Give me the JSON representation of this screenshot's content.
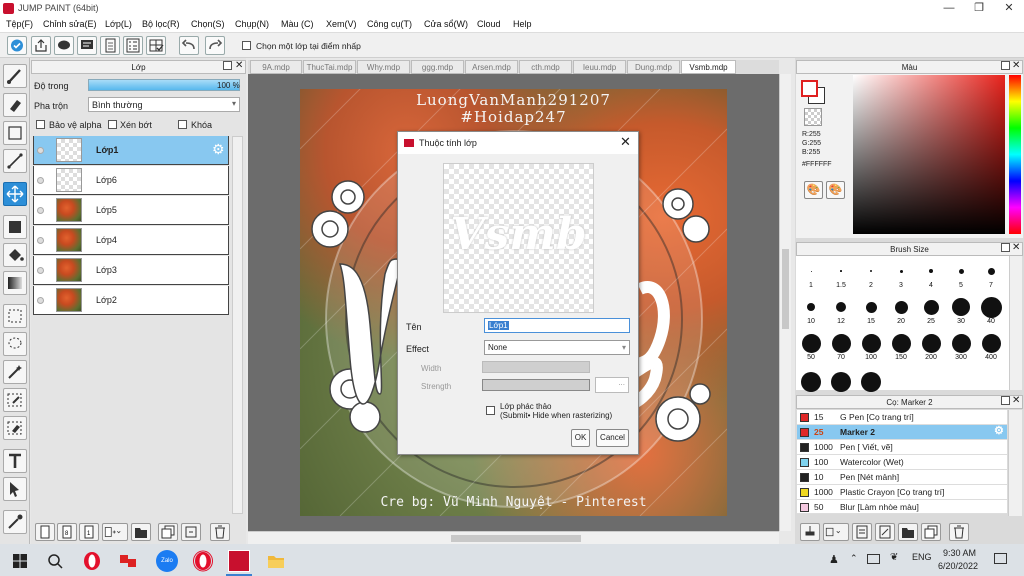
{
  "window": {
    "title": "JUMP PAINT (64bit)"
  },
  "menu": [
    "Tệp(F)",
    "Chỉnh sửa(E)",
    "Lớp(L)",
    "Bộ lọc(R)",
    "Chọn(S)",
    "Chụp(N)",
    "Màu (C)",
    "Xem(V)",
    "Công cụ(T)",
    "Cửa sổ(W)",
    "Cloud",
    "Help"
  ],
  "toolbar": {
    "reference_label": "Chọn một lớp tại điểm nhấp"
  },
  "layer_panel": {
    "title": "Lớp",
    "opacity_label": "Độ trong",
    "opacity_value": "100 %",
    "opacity_fraction": 1.0,
    "blend_label": "Pha trộn",
    "blend_value": "Bình thường",
    "protect_alpha": "Bảo vệ alpha",
    "clipping": "Xén bớt",
    "lock": "Khóa",
    "layers": [
      {
        "name": "Lớp1",
        "thumb": "transparent",
        "selected": true
      },
      {
        "name": "Lớp6",
        "thumb": "transparent",
        "selected": false
      },
      {
        "name": "Lớp5",
        "thumb": "photo",
        "selected": false
      },
      {
        "name": "Lớp4",
        "thumb": "photo",
        "selected": false
      },
      {
        "name": "Lớp3",
        "thumb": "photo",
        "selected": false
      },
      {
        "name": "Lớp2",
        "thumb": "photo",
        "selected": false
      }
    ]
  },
  "doc_tabs": [
    "9A.mdp",
    "ThucTai.mdp",
    "Why.mdp",
    "ggg.mdp",
    "Arsen.mdp",
    "cth.mdp",
    "Ieuu.mdp",
    "Dung.mdp",
    "Vsmb.mdp"
  ],
  "canvas": {
    "watermark_line1": "LuongVanManh291207",
    "watermark_line2": "#Hoidap247",
    "artwork_text": "Vsmb",
    "credit": "Cre bg: Vũ Minh Nguyệt - Pinterest"
  },
  "dialog": {
    "title": "Thuộc tính lớp",
    "name_label": "Tên",
    "name_value": "Lớp1",
    "effect_label": "Effect",
    "effect_value": "None",
    "width_label": "Width",
    "strength_label": "Strength",
    "strength_btn": "...",
    "draft_label": "Lớp phác thảo",
    "draft_note": "(Submit• Hide when rasterizing)",
    "ok": "OK",
    "cancel": "Cancel"
  },
  "color_panel": {
    "title": "Màu",
    "r": "R:255",
    "g": "G:255",
    "b": "B:255",
    "hex": "#FFFFFF",
    "primary_color": "#E02020",
    "secondary_color": "#FFFFFF"
  },
  "brush_panel": {
    "title": "Brush Size",
    "sizes": [
      "1",
      "1.5",
      "2",
      "3",
      "4",
      "5",
      "7",
      "10",
      "12",
      "15",
      "20",
      "25",
      "30",
      "40",
      "50",
      "70",
      "100",
      "150",
      "200",
      "300",
      "400"
    ]
  },
  "tool_panel": {
    "title": "Cọ: Marker 2",
    "tools": [
      {
        "size": "15",
        "name": "G Pen [Cọ trang trí]",
        "color": "#E02828",
        "selected": false
      },
      {
        "size": "25",
        "name": "Marker 2",
        "color": "#E02828",
        "selected": true
      },
      {
        "size": "1000",
        "name": "Pen [ Viết, vẽ]",
        "color": "#222222",
        "selected": false
      },
      {
        "size": "100",
        "name": "Watercolor (Wet)",
        "color": "#7FD4F0",
        "selected": false
      },
      {
        "size": "10",
        "name": "Pen [Nét mảnh]",
        "color": "#222222",
        "selected": false
      },
      {
        "size": "1000",
        "name": "Plastic Crayon [Cọ trang trí]",
        "color": "#F0D820",
        "selected": false
      },
      {
        "size": "50",
        "name": "Blur [Làm nhòe màu]",
        "color": "#F4C8E0",
        "selected": false
      }
    ]
  },
  "taskbar": {
    "time": "9:30 AM",
    "date": "6/20/2022",
    "lang": "ENG",
    "zalo": "Zalo"
  }
}
